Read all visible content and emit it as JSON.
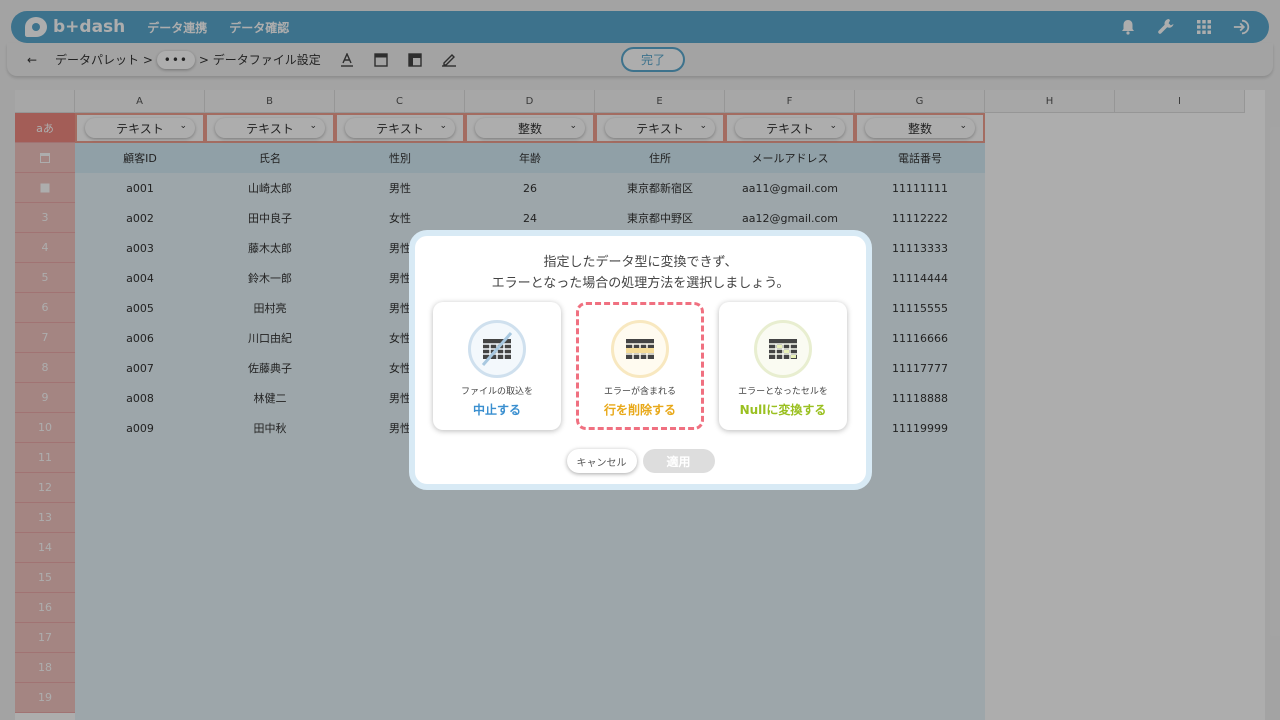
{
  "nav": {
    "logo": "b+dash",
    "links": [
      "データ連携",
      "データ確認"
    ],
    "icons": [
      "bell-icon",
      "wrench-icon",
      "apps-grid-icon",
      "logout-icon"
    ]
  },
  "subbar": {
    "back": "←",
    "crumb1": "データパレット >",
    "more": "•••",
    "crumb2": "> データファイル設定",
    "done": "完了"
  },
  "grid": {
    "columns": [
      "A",
      "B",
      "C",
      "D",
      "E",
      "F",
      "G",
      "H",
      "I"
    ],
    "corner": "aあ",
    "types": [
      "テキスト",
      "テキスト",
      "テキスト",
      "整数",
      "テキスト",
      "テキスト",
      "整数"
    ],
    "header_row": [
      "顧客ID",
      "氏名",
      "性別",
      "年齢",
      "住所",
      "メールアドレス",
      "電話番号"
    ],
    "rows": [
      [
        "a001",
        "山崎太郎",
        "男性",
        "26",
        "東京都新宿区",
        "aa11@gmail.com",
        "11111111"
      ],
      [
        "a002",
        "田中良子",
        "女性",
        "24",
        "東京都中野区",
        "aa12@gmail.com",
        "11112222"
      ],
      [
        "a003",
        "藤木太郎",
        "男性",
        "",
        "",
        "",
        "11113333"
      ],
      [
        "a004",
        "鈴木一郎",
        "男性",
        "",
        "",
        "",
        "11114444"
      ],
      [
        "a005",
        "田村亮",
        "男性",
        "",
        "",
        "",
        "11115555"
      ],
      [
        "a006",
        "川口由紀",
        "女性",
        "",
        "",
        "",
        "11116666"
      ],
      [
        "a007",
        "佐藤典子",
        "女性",
        "",
        "",
        "",
        "11117777"
      ],
      [
        "a008",
        "林健二",
        "男性",
        "",
        "",
        "",
        "11118888"
      ],
      [
        "a009",
        "田中秋",
        "男性",
        "",
        "",
        "",
        "11119999"
      ]
    ],
    "row_numbers": [
      "3",
      "4",
      "5",
      "6",
      "7",
      "8",
      "9",
      "10",
      "11",
      "12",
      "13",
      "14",
      "15",
      "16",
      "17",
      "18",
      "19"
    ]
  },
  "modal": {
    "title_line1": "指定したデータ型に変換できず、",
    "title_line2": "エラーとなった場合の処理方法を選択しましょう。",
    "options": [
      {
        "line1": "ファイルの取込を",
        "line2": "中止する",
        "color": "#3a8fd0"
      },
      {
        "line1": "エラーが含まれる",
        "line2": "行を削除する",
        "color": "#e8a818"
      },
      {
        "line1": "エラーとなったセルを",
        "line2": "Nullに変換する",
        "color": "#9ac020"
      }
    ],
    "cancel": "キャンセル",
    "apply": "適用"
  },
  "colors": {
    "brand": "#5aa9cf",
    "type_border": "#f0a090",
    "row_header": "#f2c4c0",
    "selected_dash": "#f07080"
  }
}
